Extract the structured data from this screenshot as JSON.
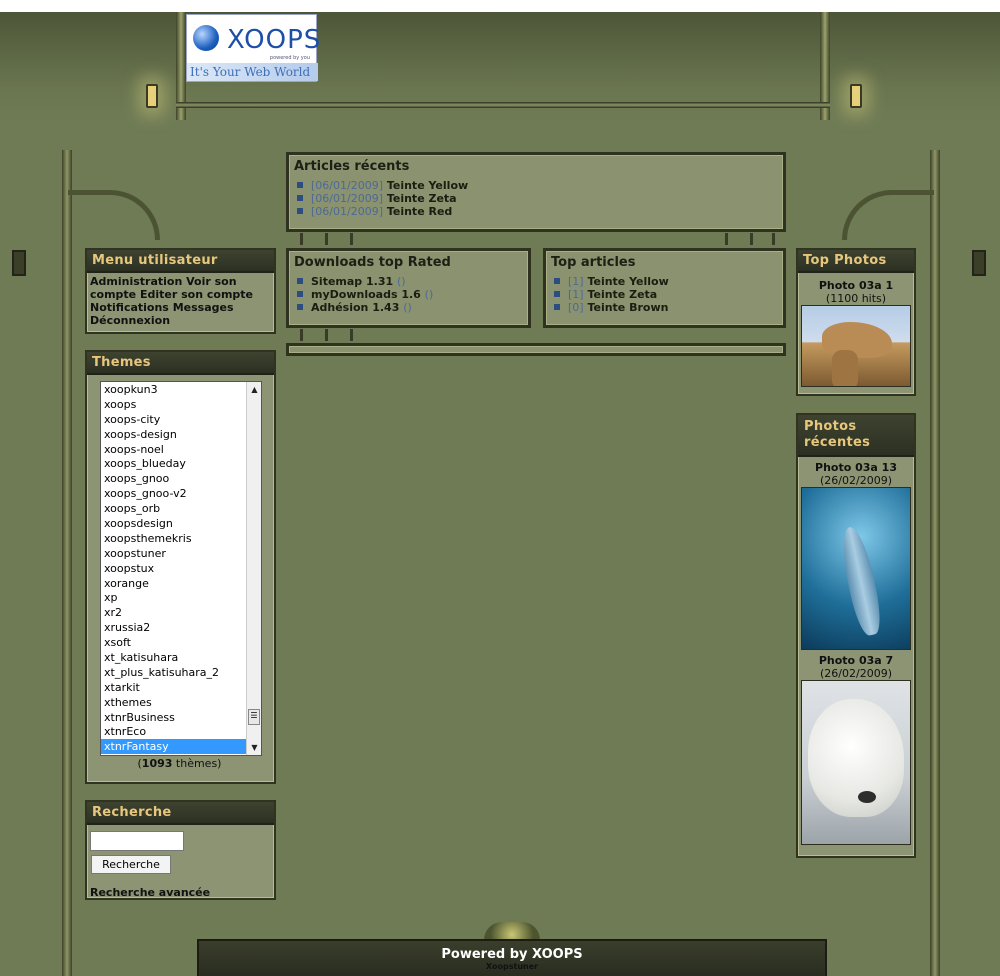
{
  "logo": {
    "word": "XOOPS",
    "powered": "powered by you",
    "slogan": "It's Your Web World"
  },
  "recent_articles": {
    "title": "Articles récents",
    "items": [
      {
        "date": "[06/01/2009]",
        "label": "Teinte Yellow"
      },
      {
        "date": "[06/01/2009]",
        "label": "Teinte Zeta"
      },
      {
        "date": "[06/01/2009]",
        "label": "Teinte Red"
      }
    ]
  },
  "downloads_top": {
    "title": "Downloads top Rated",
    "items": [
      {
        "label": "Sitemap 1.31",
        "count": "()"
      },
      {
        "label": "myDownloads 1.6",
        "count": "()"
      },
      {
        "label": "Adhésion 1.43",
        "count": "()"
      }
    ]
  },
  "top_articles": {
    "title": "Top articles",
    "items": [
      {
        "count": "[1]",
        "label": "Teinte Yellow"
      },
      {
        "count": "[1]",
        "label": "Teinte Zeta"
      },
      {
        "count": "[0]",
        "label": "Teinte Brown"
      }
    ]
  },
  "user_menu": {
    "title": "Menu utilisateur",
    "links": [
      "Administration",
      "Voir son compte",
      "Editer son compte",
      "Notifications",
      "Messages",
      "Déconnexion"
    ]
  },
  "themes": {
    "title": "Themes",
    "list": [
      "xoopkun3",
      "xoops",
      "xoops-city",
      "xoops-design",
      "xoops-noel",
      "xoops_blueday",
      "xoops_gnoo",
      "xoops_gnoo-v2",
      "xoops_orb",
      "xoopsdesign",
      "xoopsthemekris",
      "xoopstuner",
      "xoopstux",
      "xorange",
      "xp",
      "xr2",
      "xrussia2",
      "xsoft",
      "xt_katisuhara",
      "xt_plus_katisuhara_2",
      "xtarkit",
      "xthemes",
      "xtnrBusiness",
      "xtnrEco",
      "xtnrFantasy"
    ],
    "selected": "xtnrFantasy",
    "count_open": "(",
    "count_num": "1093",
    "count_rest": " thèmes)",
    "scroll_up": "▲",
    "scroll_down": "▼",
    "thumb_grip": "☰"
  },
  "search": {
    "title": "Recherche",
    "button": "Recherche",
    "advanced": "Recherche avancée",
    "value": ""
  },
  "top_photos": {
    "title": "Top Photos",
    "items": [
      {
        "name": "Photo 03a 1",
        "meta": "(1100 hits)"
      }
    ]
  },
  "recent_photos": {
    "title": "Photos récentes",
    "items": [
      {
        "name": "Photo 03a 13",
        "meta": "(26/02/2009)"
      },
      {
        "name": "Photo 03a 7",
        "meta": "(26/02/2009)"
      }
    ]
  },
  "footer": {
    "powered": "Powered by XOOPS",
    "credit": "Xoopstuner"
  },
  "colors": {
    "background": "#6f7b55",
    "block_title": "#e7c77d",
    "link_date": "#4d6a96",
    "selection": "#3399ff"
  }
}
